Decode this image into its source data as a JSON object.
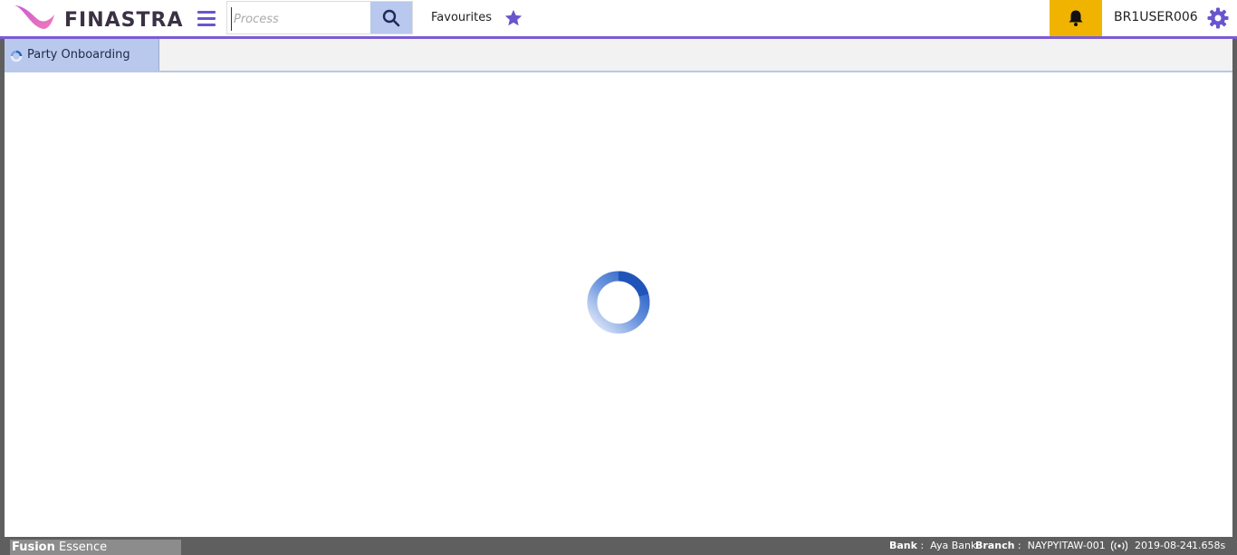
{
  "app": {
    "logo_text": "FINASTRA",
    "brand_strong": "Fusion",
    "brand_rest": "Essence"
  },
  "header": {
    "search_placeholder": "Process",
    "favourites_label": "Favourites",
    "username": "BR1USER006"
  },
  "tabs": [
    {
      "label": "Party Onboarding",
      "active": true
    }
  ],
  "status": {
    "bank_label": "Bank",
    "bank_value": "Aya Bank",
    "branch_label": "Branch",
    "branch_value": "NAYPYITAW-001",
    "date": "2019-08-24",
    "timing": "1.658s"
  },
  "colors": {
    "accent": "#7b5bd4",
    "search_button": "#b8c8ee",
    "bell_button": "#f0b400",
    "tab_active": "#b9c9ee",
    "spinner": "#2a62c4"
  },
  "icons": {
    "menu": "hamburger-icon",
    "search": "search-icon",
    "favourites": "star-icon",
    "notifications": "bell-icon",
    "settings": "gear-icon",
    "loading": "spinner-icon",
    "connection": "signal-icon"
  }
}
